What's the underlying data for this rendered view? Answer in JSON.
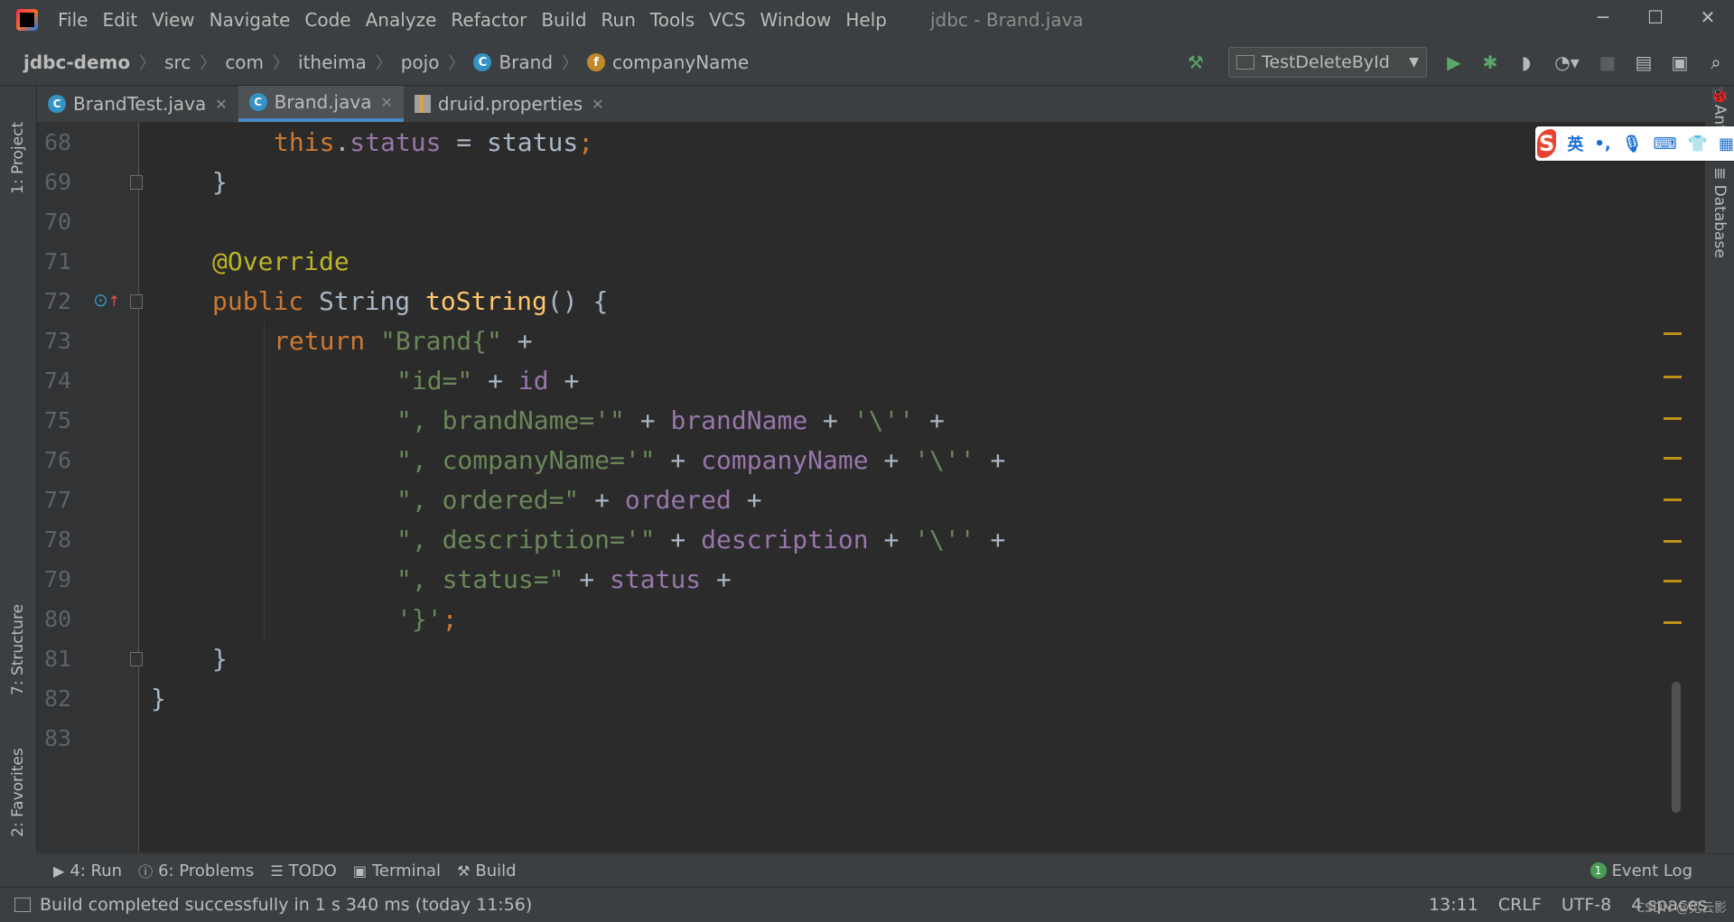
{
  "window": {
    "title": "jdbc - Brand.java",
    "controls": {
      "minimize": "─",
      "maximize": "☐",
      "close": "✕"
    }
  },
  "menu": {
    "items": [
      "File",
      "Edit",
      "View",
      "Navigate",
      "Code",
      "Analyze",
      "Refactor",
      "Build",
      "Run",
      "Tools",
      "VCS",
      "Window",
      "Help"
    ]
  },
  "breadcrumb": {
    "items": [
      "jdbc-demo",
      "src",
      "com",
      "itheima",
      "pojo",
      "Brand",
      "companyName"
    ]
  },
  "toolbar": {
    "run_config": "TestDeleteById",
    "icons": [
      "hammer-icon",
      "run-icon",
      "debug-icon",
      "coverage-icon",
      "profile-icon",
      "stop-icon",
      "project-structure-icon",
      "layout-icon",
      "search-icon"
    ]
  },
  "tabs": [
    {
      "label": "BrandTest.java",
      "active": false
    },
    {
      "label": "Brand.java",
      "active": true
    },
    {
      "label": "druid.properties",
      "active": false
    }
  ],
  "left_tools": {
    "project": "1: Project",
    "structure": "7: Structure",
    "favorites": "2: Favorites"
  },
  "right_tools": {
    "ant": "Ant",
    "database": "Database"
  },
  "editor": {
    "line_numbers": [
      "68",
      "69",
      "70",
      "71",
      "72",
      "73",
      "74",
      "75",
      "76",
      "77",
      "78",
      "79",
      "80",
      "81",
      "82",
      "83"
    ],
    "code": {
      "l68": {
        "this": "this",
        "dot": ".",
        "field": "status",
        "eq": " = ",
        "var": "status",
        "semi": ";"
      },
      "l69": "}",
      "l71": "@Override",
      "l72": {
        "kw": "public ",
        "type": "String ",
        "fn": "toString",
        "rest": "() {"
      },
      "l73": {
        "kw": "return ",
        "str": "\"Brand{\"",
        "op": " +"
      },
      "l74": {
        "str": "\"id=\"",
        "op1": " + ",
        "field": "id",
        "op2": " +"
      },
      "l75": {
        "str": "\", brandName='\"",
        "op1": " + ",
        "field": "brandName",
        "op2": " + ",
        "ch": "'\\''",
        "op3": " +"
      },
      "l76": {
        "str": "\", companyName='\"",
        "op1": " + ",
        "field": "companyName",
        "op2": " + ",
        "ch": "'\\''",
        "op3": " +"
      },
      "l77": {
        "str": "\", ordered=\"",
        "op1": " + ",
        "field": "ordered",
        "op2": " +"
      },
      "l78": {
        "str": "\", description='\"",
        "op1": " + ",
        "field": "description",
        "op2": " + ",
        "ch": "'\\''",
        "op3": " +"
      },
      "l79": {
        "str": "\", status=\"",
        "op1": " + ",
        "field": "status",
        "op2": " +"
      },
      "l80": {
        "ch": "'}'",
        "semi": ";"
      },
      "l81": "}",
      "l82": "}"
    }
  },
  "bottom_tabs": [
    {
      "label": "4: Run",
      "icon": "run-icon"
    },
    {
      "label": "6: Problems",
      "icon": "problems-icon"
    },
    {
      "label": "TODO",
      "icon": "todo-icon"
    },
    {
      "label": "Terminal",
      "icon": "terminal-icon"
    },
    {
      "label": "Build",
      "icon": "hammer-icon"
    }
  ],
  "event_log": {
    "count": "1",
    "label": "Event Log"
  },
  "status": {
    "message": "Build completed successfully in 1 s 340 ms (today 11:56)",
    "position": "13:11",
    "line_sep": "CRLF",
    "encoding": "UTF-8",
    "indent": "4 spaces"
  },
  "ime": {
    "logo": "S",
    "mode": "英",
    "punct": "•,"
  },
  "watermark": "CSDN @见云影",
  "colors": {
    "background": "#2b2b2b",
    "keyword": "#cc7832",
    "string": "#6a8759",
    "field": "#9876aa",
    "function": "#ffc66d",
    "annotation": "#bbb529",
    "tab_accent": "#4a88c7"
  }
}
